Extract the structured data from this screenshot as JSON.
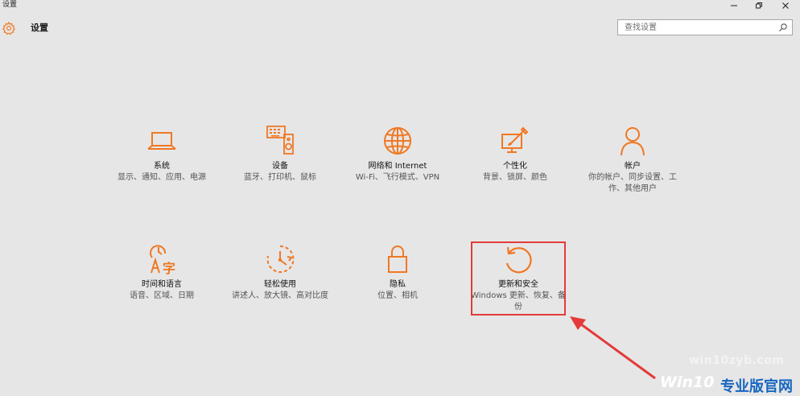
{
  "window": {
    "title": "设置",
    "minimize_icon": "minimize-icon",
    "restore_icon": "restore-icon",
    "close_icon": "close-icon"
  },
  "header": {
    "title": "设置",
    "icon": "gear-icon"
  },
  "search": {
    "placeholder": "查找设置",
    "value": "",
    "icon": "search-icon"
  },
  "colors": {
    "accent": "#f07823",
    "background": "#e6e6e6",
    "highlight": "#e53a3a"
  },
  "tiles": [
    {
      "label": "系统",
      "desc": "显示、通知、应用、电源",
      "icon": "laptop-icon"
    },
    {
      "label": "设备",
      "desc": "蓝牙、打印机、鼠标",
      "icon": "keyboard-speaker-icon"
    },
    {
      "label": "网络和 Internet",
      "desc": "Wi-Fi、飞行模式、VPN",
      "icon": "globe-icon"
    },
    {
      "label": "个性化",
      "desc": "背景、锁屏、颜色",
      "icon": "paint-display-icon"
    },
    {
      "label": "帐户",
      "desc": "你的帐户、同步设置、工作、其他用户",
      "icon": "person-icon"
    },
    {
      "label": "时间和语言",
      "desc": "语音、区域、日期",
      "icon": "time-language-icon"
    },
    {
      "label": "轻松使用",
      "desc": "讲述人、放大镜、高对比度",
      "icon": "ease-of-access-icon"
    },
    {
      "label": "隐私",
      "desc": "位置、相机",
      "icon": "lock-icon"
    },
    {
      "label": "更新和安全",
      "desc": "Windows 更新、恢复、备份",
      "icon": "refresh-icon"
    }
  ],
  "watermark": {
    "url": "win10zyb.com",
    "brand": "Win10",
    "brand_suffix": "专业版官网"
  }
}
